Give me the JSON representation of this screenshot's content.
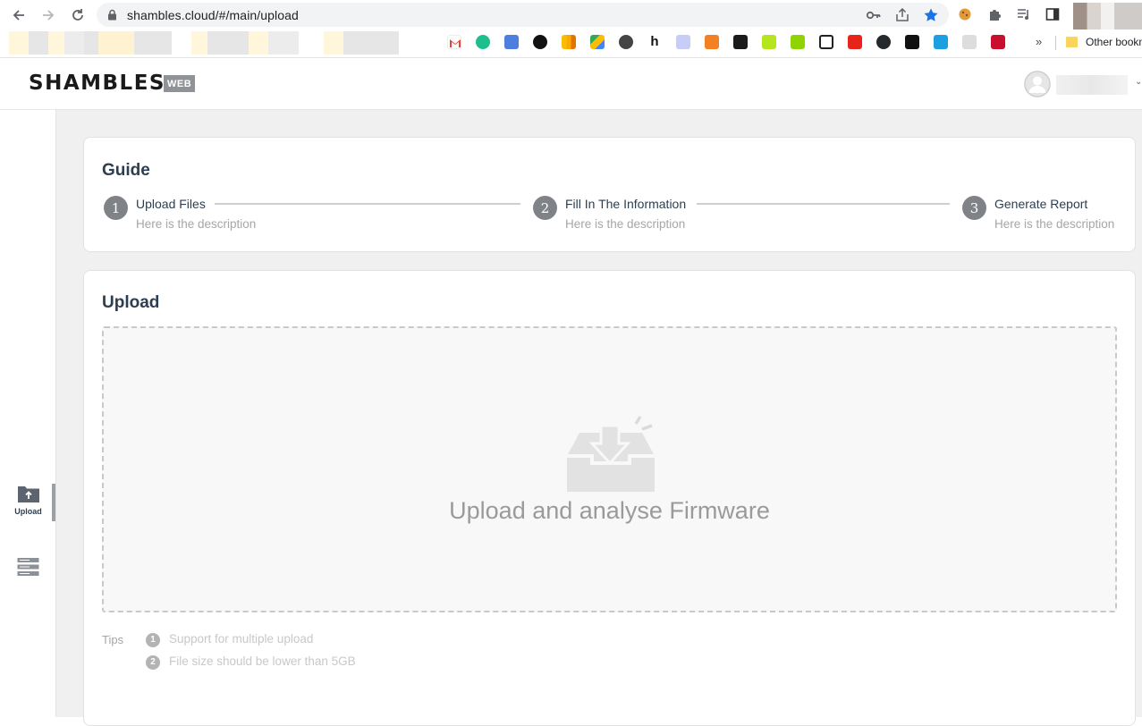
{
  "browser": {
    "url": "shambles.cloud/#/main/upload",
    "other_bookmarks": "Other bookm"
  },
  "app": {
    "logo": "SHAMBLES",
    "badge": "WEB"
  },
  "sidebar": {
    "items": [
      {
        "label": "Upload",
        "icon": "upload-folder-icon",
        "active": true
      },
      {
        "label": "",
        "icon": "report-list-icon",
        "active": false
      }
    ]
  },
  "guide": {
    "title": "Guide",
    "steps": [
      {
        "num": "1",
        "title": "Upload Files",
        "desc": "Here is the description"
      },
      {
        "num": "2",
        "title": "Fill In The Information",
        "desc": "Here is the description"
      },
      {
        "num": "3",
        "title": "Generate Report",
        "desc": "Here is the description"
      }
    ]
  },
  "upload": {
    "title": "Upload",
    "dropzone_text": "Upload and analyse Firmware",
    "tips_label": "Tips",
    "tips": [
      {
        "num": "1",
        "text": "Support for multiple upload"
      },
      {
        "num": "2",
        "text": "File size should be lower than 5GB"
      }
    ]
  },
  "colors": {
    "accent_blue": "#1a73e8",
    "title_text": "#2c3e50",
    "step_circle": "#7f8387"
  }
}
